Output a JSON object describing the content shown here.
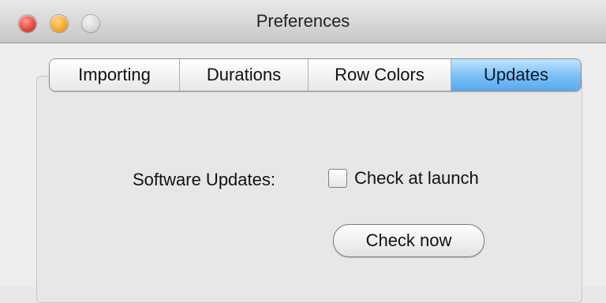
{
  "window": {
    "title": "Preferences"
  },
  "tabs": [
    {
      "label": "Importing",
      "active": false
    },
    {
      "label": "Durations",
      "active": false
    },
    {
      "label": "Row Colors",
      "active": false
    },
    {
      "label": "Updates",
      "active": true
    }
  ],
  "updates": {
    "software_updates_label": "Software Updates:",
    "check_at_launch_label": "Check at launch",
    "check_at_launch_checked": false,
    "check_now_button": "Check now"
  },
  "colors": {
    "active_tab": "#79bef4",
    "close": "#e0443a",
    "minimize": "#f5a623",
    "zoom_disabled": "#d7d7d7"
  }
}
